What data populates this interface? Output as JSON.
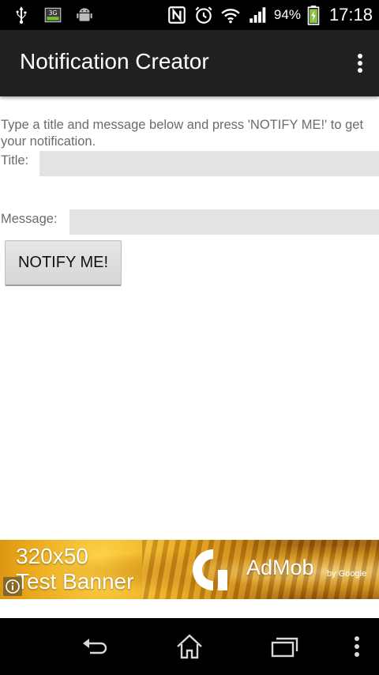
{
  "status_bar": {
    "left_icons": [
      "usb-icon",
      "3g-icon",
      "android-icon"
    ],
    "right_icons": [
      "nfc-icon",
      "alarm-icon",
      "wifi-icon",
      "signal-icon",
      "battery-icon"
    ],
    "battery_percent": "94%",
    "time": "17:18"
  },
  "action_bar": {
    "title": "Notification Creator",
    "overflow_icon": "overflow-menu-icon"
  },
  "content": {
    "instructions": "Type a title and message below and press 'NOTIFY ME!' to get your notification.",
    "title_label": "Title:",
    "title_value": "",
    "message_label": "Message:",
    "message_value": "",
    "notify_button": "NOTIFY ME!"
  },
  "ad": {
    "size_text": "320x50",
    "test_text": "Test Banner",
    "brand": "AdMob",
    "by_text": "by Google",
    "info_icon": "info-icon"
  },
  "nav_bar": {
    "icons": [
      "back-icon",
      "home-icon",
      "recents-icon",
      "menu-icon"
    ]
  },
  "colors": {
    "action_bar": "#212121",
    "input_bg": "#e3e3e6",
    "label_text": "#6b6b6b",
    "ad_gold": "#e8a417"
  }
}
